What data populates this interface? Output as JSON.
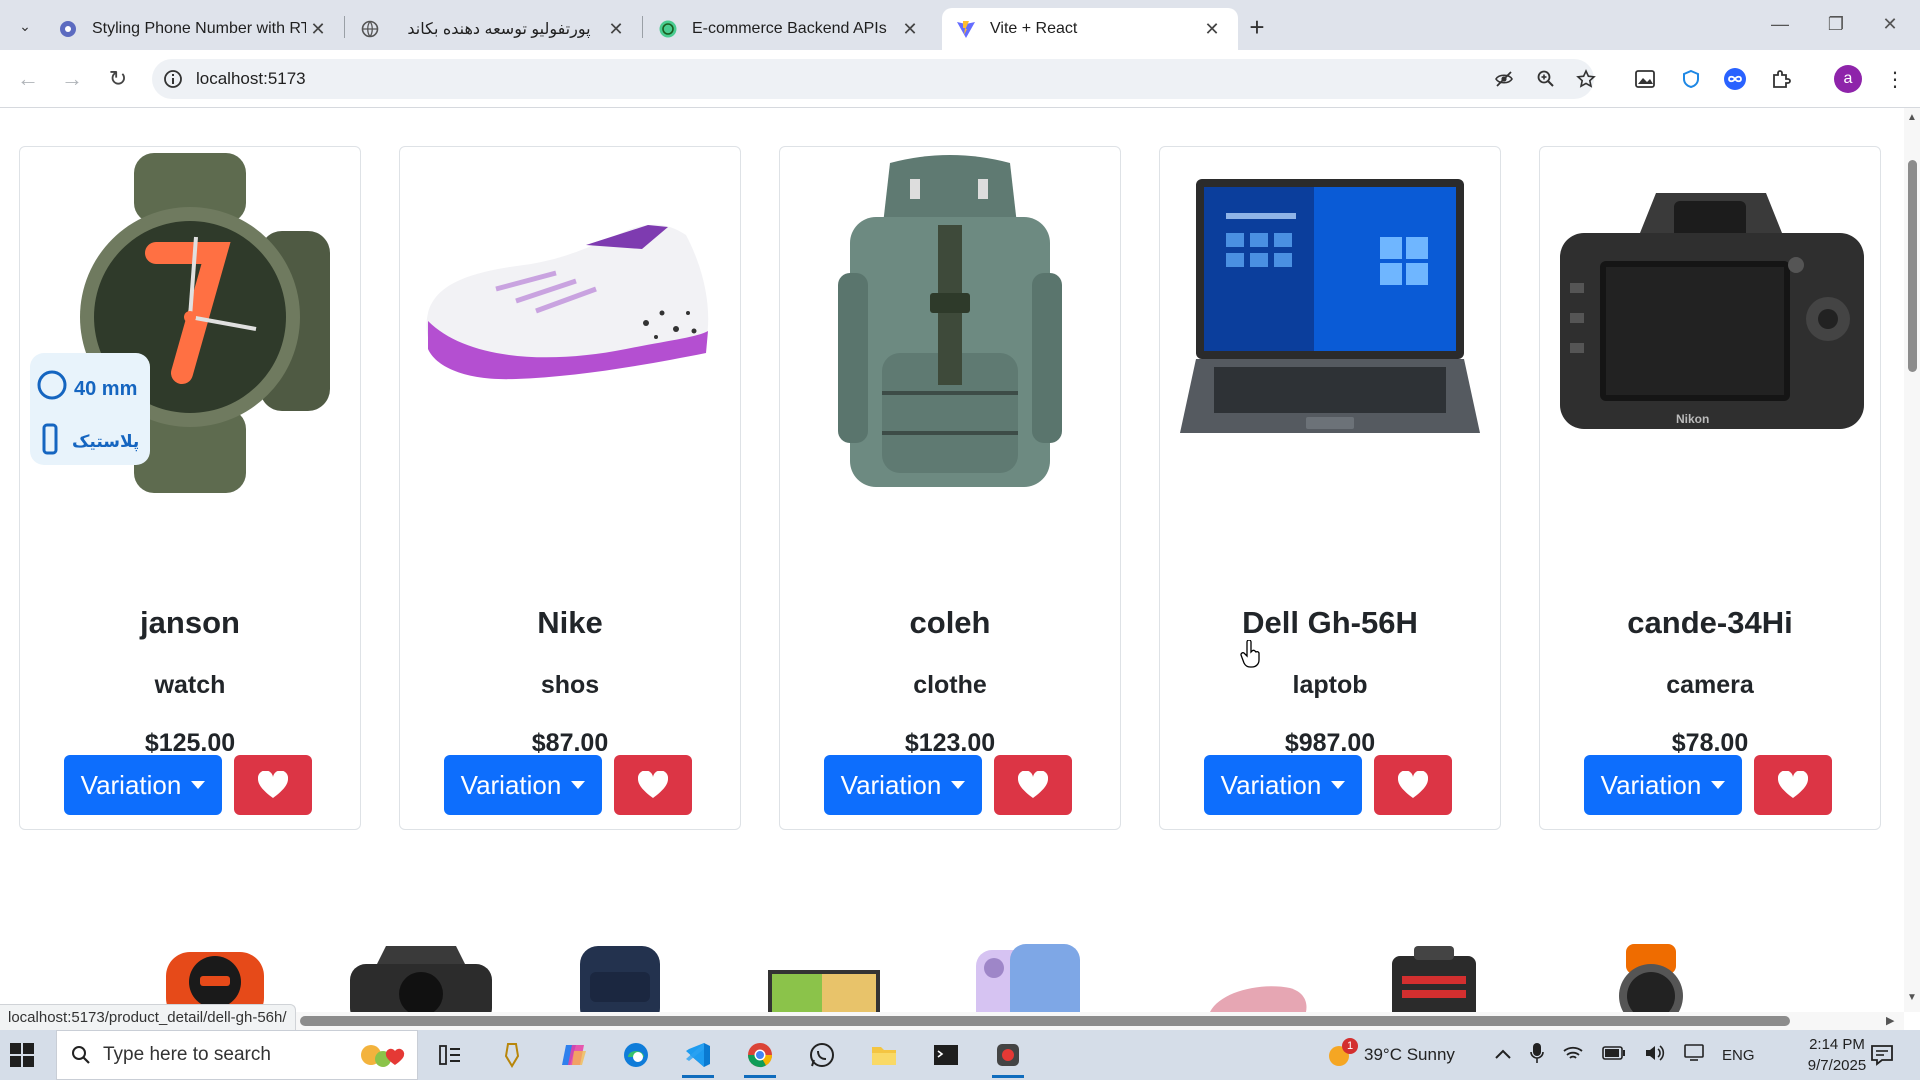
{
  "browser": {
    "tabs": [
      {
        "title": "Styling Phone Number with RTL",
        "active": false
      },
      {
        "title": "پورتفولیو توسعه دهنده بکاند",
        "active": false
      },
      {
        "title": "E-commerce Backend APIs",
        "active": false
      },
      {
        "title": "Vite + React",
        "active": true
      }
    ],
    "address": "localhost:5173",
    "profile_initial": "a",
    "status_url": "localhost:5173/product_detail/dell-gh-56h/"
  },
  "products": [
    {
      "name": "janson",
      "category": "watch",
      "price": "$125.00",
      "variation_label": "Variation",
      "badge_size": "40 mm",
      "badge_material": "پلاستیک"
    },
    {
      "name": "Nike",
      "category": "shos",
      "price": "$87.00",
      "variation_label": "Variation"
    },
    {
      "name": "coleh",
      "category": "clothe",
      "price": "$123.00",
      "variation_label": "Variation"
    },
    {
      "name": "Dell Gh-56H",
      "category": "laptob",
      "price": "$987.00",
      "variation_label": "Variation"
    },
    {
      "name": "cande-34Hi",
      "category": "camera",
      "price": "$78.00",
      "variation_label": "Variation",
      "brand_text": "Nikon"
    }
  ],
  "taskbar": {
    "search_placeholder": "Type here to search",
    "weather": "39°C  Sunny",
    "weather_badge": "1",
    "language": "ENG",
    "time": "2:14 PM",
    "date": "9/7/2025"
  },
  "colors": {
    "primary": "#0d6efd",
    "danger": "#dc3545"
  }
}
